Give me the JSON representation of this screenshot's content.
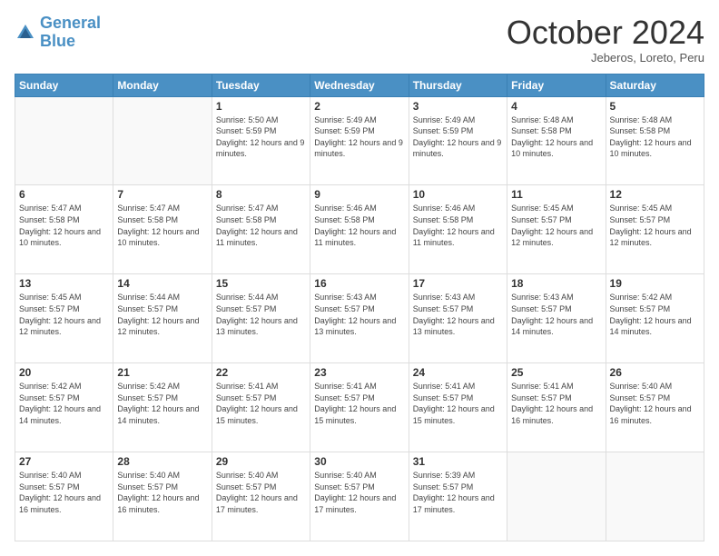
{
  "logo": {
    "line1": "General",
    "line2": "Blue"
  },
  "header": {
    "month": "October 2024",
    "location": "Jeberos, Loreto, Peru"
  },
  "weekdays": [
    "Sunday",
    "Monday",
    "Tuesday",
    "Wednesday",
    "Thursday",
    "Friday",
    "Saturday"
  ],
  "weeks": [
    [
      {
        "day": "",
        "info": ""
      },
      {
        "day": "",
        "info": ""
      },
      {
        "day": "1",
        "info": "Sunrise: 5:50 AM\nSunset: 5:59 PM\nDaylight: 12 hours and 9 minutes."
      },
      {
        "day": "2",
        "info": "Sunrise: 5:49 AM\nSunset: 5:59 PM\nDaylight: 12 hours and 9 minutes."
      },
      {
        "day": "3",
        "info": "Sunrise: 5:49 AM\nSunset: 5:59 PM\nDaylight: 12 hours and 9 minutes."
      },
      {
        "day": "4",
        "info": "Sunrise: 5:48 AM\nSunset: 5:58 PM\nDaylight: 12 hours and 10 minutes."
      },
      {
        "day": "5",
        "info": "Sunrise: 5:48 AM\nSunset: 5:58 PM\nDaylight: 12 hours and 10 minutes."
      }
    ],
    [
      {
        "day": "6",
        "info": "Sunrise: 5:47 AM\nSunset: 5:58 PM\nDaylight: 12 hours and 10 minutes."
      },
      {
        "day": "7",
        "info": "Sunrise: 5:47 AM\nSunset: 5:58 PM\nDaylight: 12 hours and 10 minutes."
      },
      {
        "day": "8",
        "info": "Sunrise: 5:47 AM\nSunset: 5:58 PM\nDaylight: 12 hours and 11 minutes."
      },
      {
        "day": "9",
        "info": "Sunrise: 5:46 AM\nSunset: 5:58 PM\nDaylight: 12 hours and 11 minutes."
      },
      {
        "day": "10",
        "info": "Sunrise: 5:46 AM\nSunset: 5:58 PM\nDaylight: 12 hours and 11 minutes."
      },
      {
        "day": "11",
        "info": "Sunrise: 5:45 AM\nSunset: 5:57 PM\nDaylight: 12 hours and 12 minutes."
      },
      {
        "day": "12",
        "info": "Sunrise: 5:45 AM\nSunset: 5:57 PM\nDaylight: 12 hours and 12 minutes."
      }
    ],
    [
      {
        "day": "13",
        "info": "Sunrise: 5:45 AM\nSunset: 5:57 PM\nDaylight: 12 hours and 12 minutes."
      },
      {
        "day": "14",
        "info": "Sunrise: 5:44 AM\nSunset: 5:57 PM\nDaylight: 12 hours and 12 minutes."
      },
      {
        "day": "15",
        "info": "Sunrise: 5:44 AM\nSunset: 5:57 PM\nDaylight: 12 hours and 13 minutes."
      },
      {
        "day": "16",
        "info": "Sunrise: 5:43 AM\nSunset: 5:57 PM\nDaylight: 12 hours and 13 minutes."
      },
      {
        "day": "17",
        "info": "Sunrise: 5:43 AM\nSunset: 5:57 PM\nDaylight: 12 hours and 13 minutes."
      },
      {
        "day": "18",
        "info": "Sunrise: 5:43 AM\nSunset: 5:57 PM\nDaylight: 12 hours and 14 minutes."
      },
      {
        "day": "19",
        "info": "Sunrise: 5:42 AM\nSunset: 5:57 PM\nDaylight: 12 hours and 14 minutes."
      }
    ],
    [
      {
        "day": "20",
        "info": "Sunrise: 5:42 AM\nSunset: 5:57 PM\nDaylight: 12 hours and 14 minutes."
      },
      {
        "day": "21",
        "info": "Sunrise: 5:42 AM\nSunset: 5:57 PM\nDaylight: 12 hours and 14 minutes."
      },
      {
        "day": "22",
        "info": "Sunrise: 5:41 AM\nSunset: 5:57 PM\nDaylight: 12 hours and 15 minutes."
      },
      {
        "day": "23",
        "info": "Sunrise: 5:41 AM\nSunset: 5:57 PM\nDaylight: 12 hours and 15 minutes."
      },
      {
        "day": "24",
        "info": "Sunrise: 5:41 AM\nSunset: 5:57 PM\nDaylight: 12 hours and 15 minutes."
      },
      {
        "day": "25",
        "info": "Sunrise: 5:41 AM\nSunset: 5:57 PM\nDaylight: 12 hours and 16 minutes."
      },
      {
        "day": "26",
        "info": "Sunrise: 5:40 AM\nSunset: 5:57 PM\nDaylight: 12 hours and 16 minutes."
      }
    ],
    [
      {
        "day": "27",
        "info": "Sunrise: 5:40 AM\nSunset: 5:57 PM\nDaylight: 12 hours and 16 minutes."
      },
      {
        "day": "28",
        "info": "Sunrise: 5:40 AM\nSunset: 5:57 PM\nDaylight: 12 hours and 16 minutes."
      },
      {
        "day": "29",
        "info": "Sunrise: 5:40 AM\nSunset: 5:57 PM\nDaylight: 12 hours and 17 minutes."
      },
      {
        "day": "30",
        "info": "Sunrise: 5:40 AM\nSunset: 5:57 PM\nDaylight: 12 hours and 17 minutes."
      },
      {
        "day": "31",
        "info": "Sunrise: 5:39 AM\nSunset: 5:57 PM\nDaylight: 12 hours and 17 minutes."
      },
      {
        "day": "",
        "info": ""
      },
      {
        "day": "",
        "info": ""
      }
    ]
  ]
}
